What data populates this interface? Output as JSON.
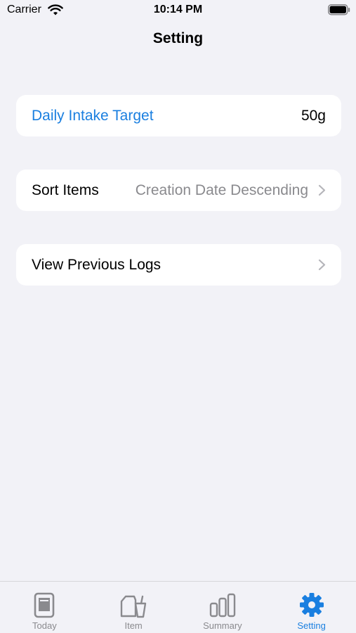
{
  "status_bar": {
    "carrier": "Carrier",
    "time": "10:14 PM"
  },
  "nav": {
    "title": "Setting"
  },
  "settings": {
    "daily_intake": {
      "label": "Daily Intake Target",
      "value": "50g"
    },
    "sort_items": {
      "label": "Sort Items",
      "value": "Creation Date Descending"
    },
    "previous_logs": {
      "label": "View Previous Logs"
    }
  },
  "tabs": [
    {
      "label": "Today",
      "icon": "today-icon"
    },
    {
      "label": "Item",
      "icon": "item-icon"
    },
    {
      "label": "Summary",
      "icon": "summary-icon"
    },
    {
      "label": "Setting",
      "icon": "gear-icon",
      "active": true
    }
  ],
  "colors": {
    "accent": "#1a7fe0",
    "inactive": "#8a8a8e",
    "background": "#f2f2f7"
  }
}
